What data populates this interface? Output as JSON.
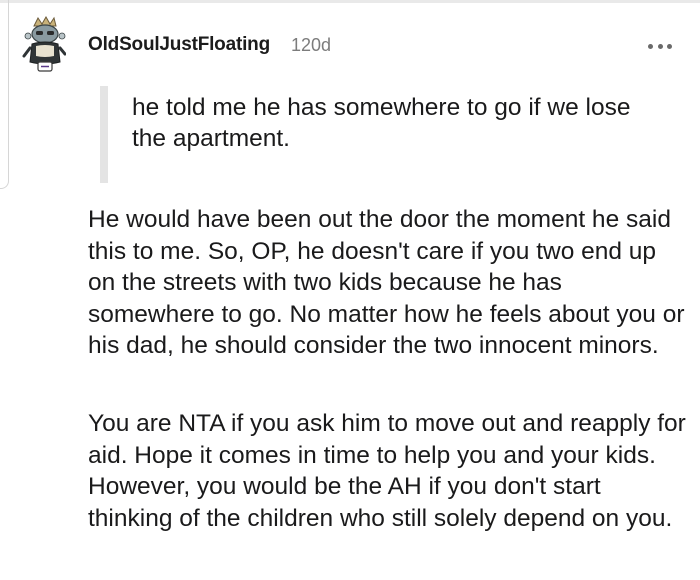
{
  "comment": {
    "username": "OldSoulJustFloating",
    "age": "120d",
    "avatar_icon": "snoo-avatar-icon",
    "more_icon": "more-options-icon",
    "quote": "he told me he has somewhere to go if we lose the apartment.",
    "paragraphs": [
      "He would have been out the door the moment he said this to me. So, OP, he doesn't care if you two end up on the streets with two kids because he has somewhere to go. No matter how he feels about you or his dad, he should consider the two innocent minors.",
      "You are NTA if you ask him to move out and reapply for aid. Hope it comes in time to help you and your kids. However, you would be the AH if you don't start thinking of the children who still solely depend on you."
    ]
  }
}
